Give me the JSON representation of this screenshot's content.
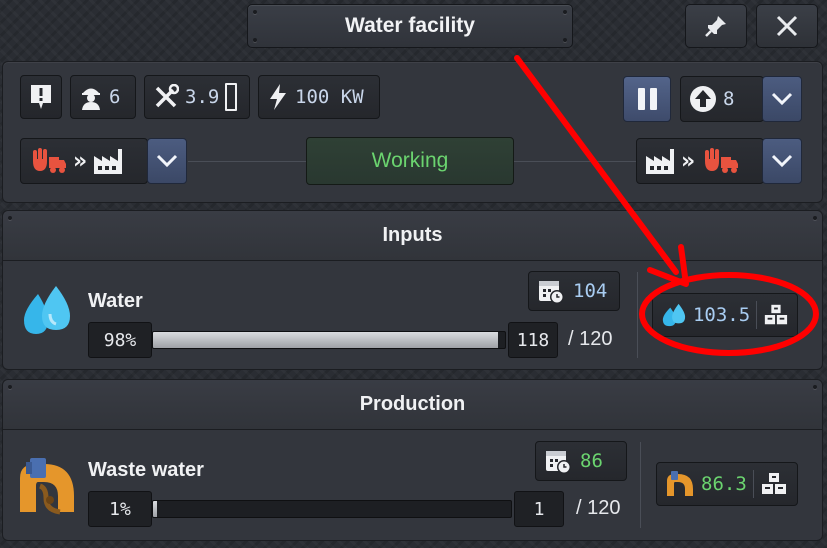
{
  "window": {
    "title": "Water facility",
    "pin_icon": "pin-icon",
    "close_icon": "close-icon"
  },
  "toolbar": {
    "workers": "6",
    "maintenance": "3.9",
    "power": "100 KW",
    "priority": "8"
  },
  "logistics": {
    "status": "Working",
    "status_color": "#6bd46f"
  },
  "inputs": {
    "heading": "Inputs",
    "items": [
      {
        "name": "Water",
        "percent": "98%",
        "fill": 0.98,
        "stored": "118",
        "capacity": "/ 120",
        "scheduled": "104",
        "rate": "103.5",
        "rate_color": "#a9cdf2"
      }
    ]
  },
  "production": {
    "heading": "Production",
    "items": [
      {
        "name": "Waste water",
        "percent": "1%",
        "fill": 0.01,
        "stored": "1",
        "capacity": "/ 120",
        "scheduled": "86",
        "rate": "86.3",
        "rate_color": "#6bd46f"
      }
    ]
  },
  "colors": {
    "accent_blue": "#4c5c80",
    "annotation_red": "#ff0000"
  }
}
